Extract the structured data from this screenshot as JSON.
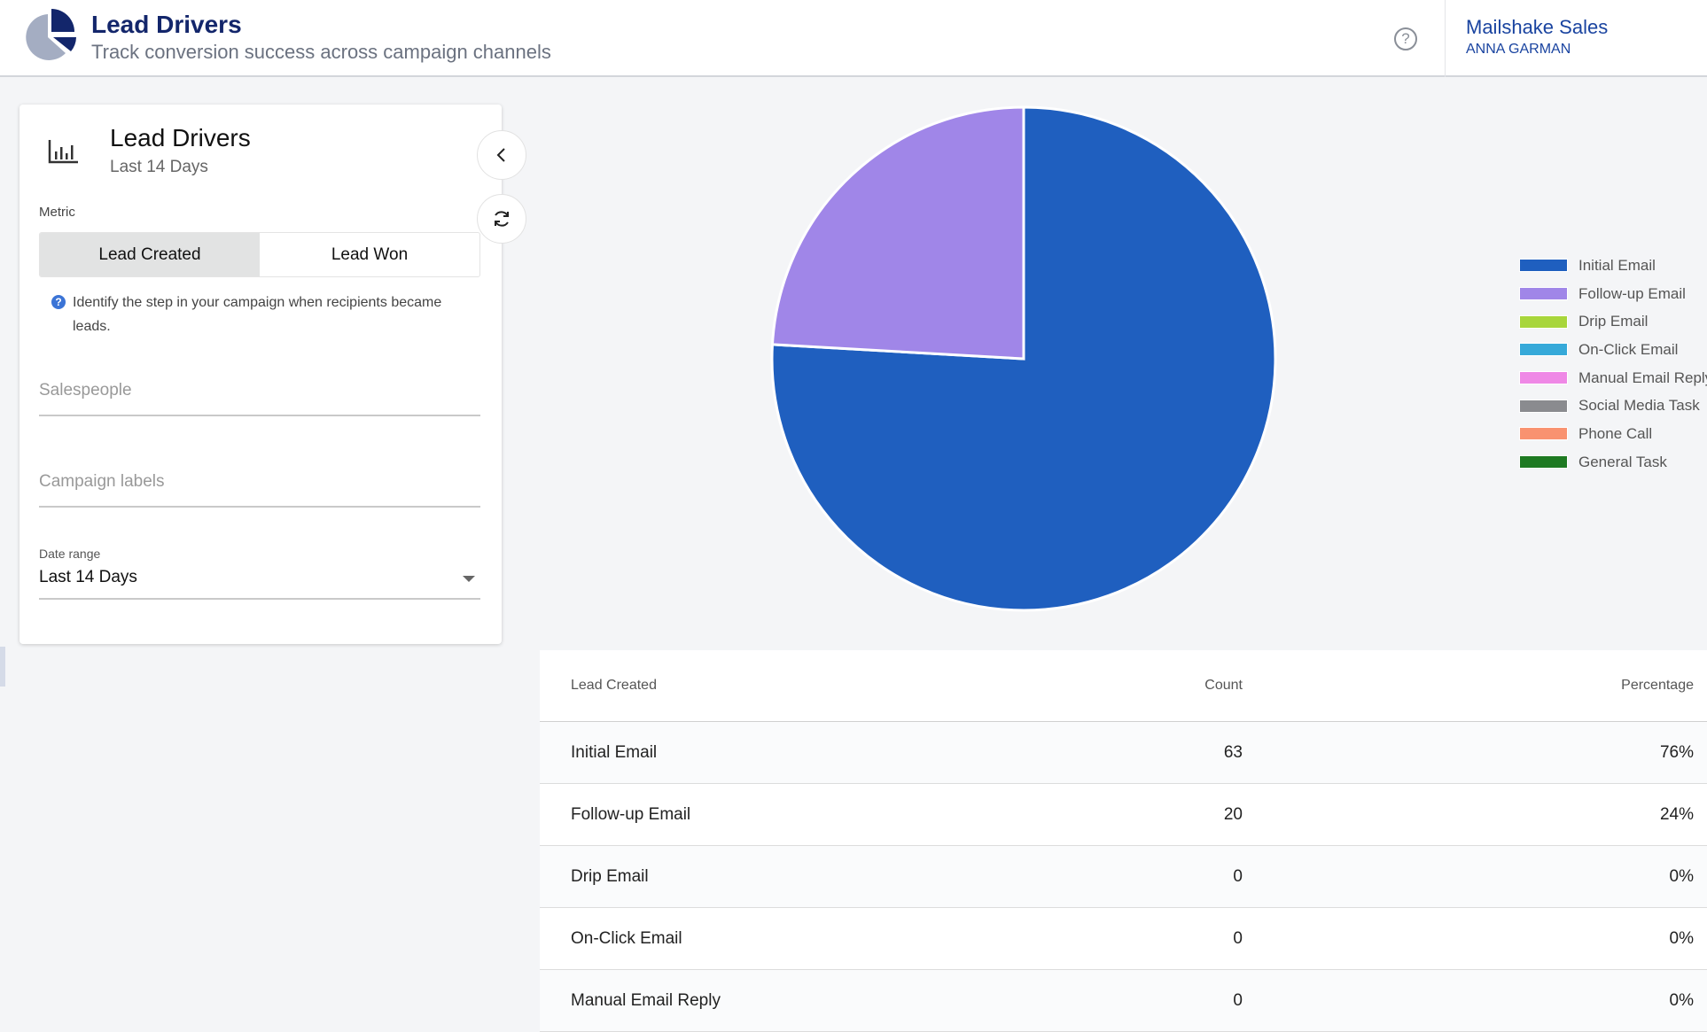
{
  "header": {
    "title": "Lead Drivers",
    "subtitle": "Track conversion success across campaign channels",
    "help_icon": "help-circle-icon",
    "account": {
      "org": "Mailshake Sales",
      "user": "ANNA GARMAN"
    }
  },
  "panel": {
    "title": "Lead Drivers",
    "subtitle": "Last 14 Days",
    "metric_label": "Metric",
    "metric_options": [
      "Lead Created",
      "Lead Won"
    ],
    "metric_selected": "Lead Created",
    "hint": "Identify the step in your campaign when recipients became leads.",
    "salespeople_placeholder": "Salespeople",
    "campaign_labels_placeholder": "Campaign labels",
    "date_range_label": "Date range",
    "date_range_value": "Last 14 Days"
  },
  "legend": [
    {
      "label": "Initial Email",
      "color": "#1f5fbf"
    },
    {
      "label": "Follow-up Email",
      "color": "#a086e8"
    },
    {
      "label": "Drip Email",
      "color": "#a8d63b"
    },
    {
      "label": "On-Click Email",
      "color": "#36a9d9"
    },
    {
      "label": "Manual Email Reply",
      "color": "#ef88e6"
    },
    {
      "label": "Social Media Task",
      "color": "#8a8b8f"
    },
    {
      "label": "Phone Call",
      "color": "#f99270"
    },
    {
      "label": "General Task",
      "color": "#1e7a22"
    }
  ],
  "table": {
    "headers": [
      "Lead Created",
      "Count",
      "Percentage"
    ],
    "rows": [
      [
        "Initial Email",
        "63",
        "76%"
      ],
      [
        "Follow-up Email",
        "20",
        "24%"
      ],
      [
        "Drip Email",
        "0",
        "0%"
      ],
      [
        "On-Click Email",
        "0",
        "0%"
      ],
      [
        "Manual Email Reply",
        "0",
        "0%"
      ]
    ]
  },
  "chart_data": {
    "type": "pie",
    "categories": [
      "Initial Email",
      "Follow-up Email",
      "Drip Email",
      "On-Click Email",
      "Manual Email Reply"
    ],
    "values": [
      63,
      20,
      0,
      0,
      0
    ],
    "colors": [
      "#1f5fbf",
      "#a086e8",
      "#a8d63b",
      "#36a9d9",
      "#ef88e6"
    ],
    "legend_placement": "right"
  }
}
